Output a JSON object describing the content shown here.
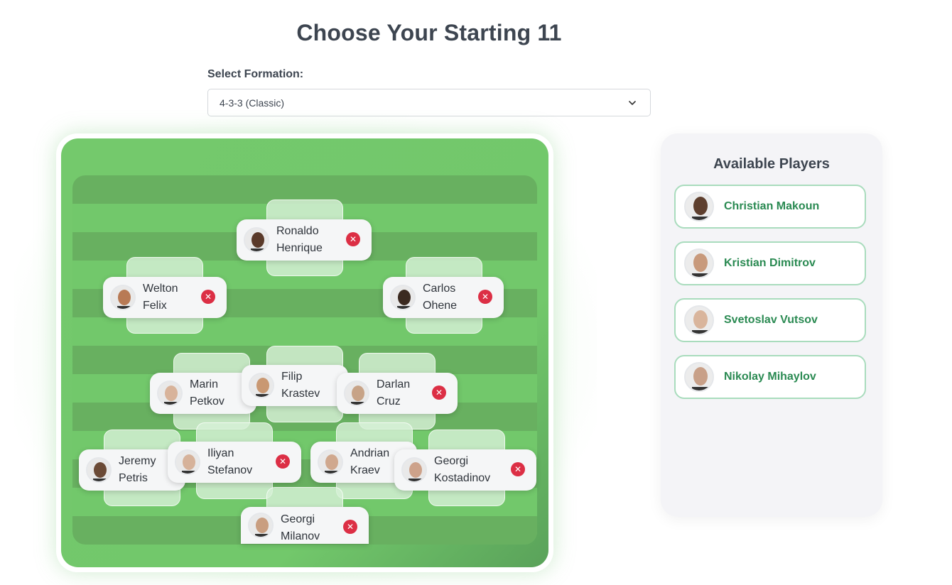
{
  "title": "Choose Your Starting 11",
  "formation": {
    "label": "Select Formation:",
    "selected": "4-3-3 (Classic)"
  },
  "lineup": [
    {
      "first": "Ronaldo",
      "last": "Henrique",
      "skin": "#5a3a2a"
    },
    {
      "first": "Welton",
      "last": "Felix",
      "skin": "#b87a55"
    },
    {
      "first": "Carlos",
      "last": "Ohene",
      "skin": "#3b2a20"
    },
    {
      "first": "Marin",
      "last": "Petkov",
      "skin": "#d8b39a"
    },
    {
      "first": "Filip",
      "last": "Krastev",
      "skin": "#c99872"
    },
    {
      "first": "Darlan",
      "last": "Cruz",
      "skin": "#c7a387"
    },
    {
      "first": "Jeremy",
      "last": "Petris",
      "skin": "#6b4a36"
    },
    {
      "first": "Iliyan",
      "last": "Stefanov",
      "skin": "#d6b29a"
    },
    {
      "first": "Andrian",
      "last": "Kraev",
      "skin": "#d0a88e"
    },
    {
      "first": "Georgi",
      "last": "Kostadinov",
      "skin": "#cda28a"
    },
    {
      "first": "Georgi",
      "last": "Milanov",
      "skin": "#c99e80"
    }
  ],
  "remove_symbol": "✕",
  "sidebar": {
    "title": "Available Players",
    "players": [
      {
        "name": "Christian Makoun",
        "skin": "#5e3f2e"
      },
      {
        "name": "Kristian Dimitrov",
        "skin": "#c89a7c"
      },
      {
        "name": "Svetoslav Vutsov",
        "skin": "#d9b59c"
      },
      {
        "name": "Nikolay Mihaylov",
        "skin": "#c8a088"
      }
    ]
  },
  "colors": {
    "remove": "#dc2f45",
    "available_name": "#2a8a52",
    "pitch": "#72c86b"
  }
}
